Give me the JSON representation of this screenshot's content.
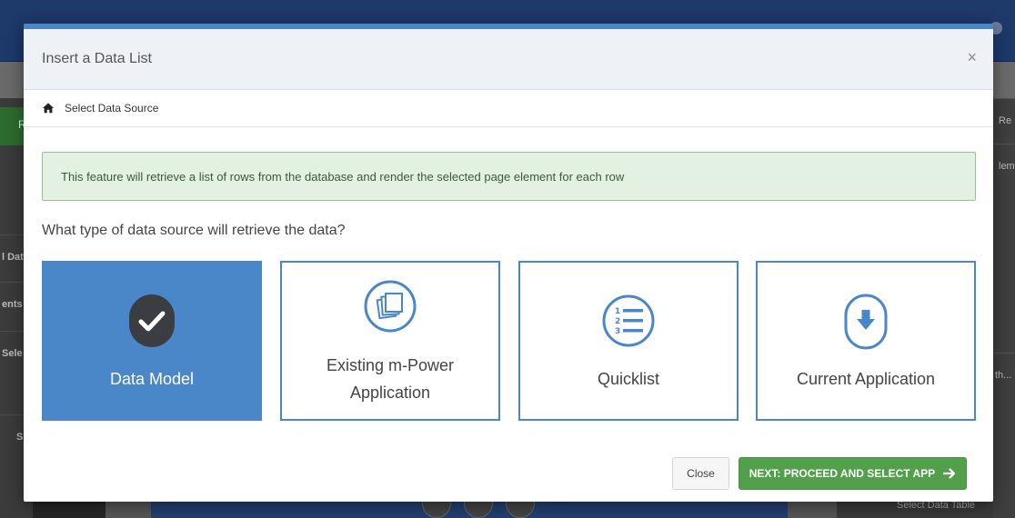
{
  "background": {
    "left_items": [
      "R",
      "l Dat",
      "ents",
      "Sele",
      "S"
    ],
    "right_items": [
      "Re",
      "lem",
      "th...",
      ""
    ],
    "bottom_right_label": "Select Data Table"
  },
  "modal": {
    "title": "Insert a Data List",
    "close_symbol": "×",
    "breadcrumb": "Select Data Source",
    "alert": "This feature will retrieve a list of rows from the database and render the selected page element for each row",
    "question": "What type of data source will retrieve the data?",
    "cards": [
      {
        "label": "Data Model",
        "icon": "check-icon",
        "selected": true
      },
      {
        "label_line1": "Existing m-Power",
        "label_line2": "Application",
        "icon": "copy-pages-icon",
        "selected": false
      },
      {
        "label": "Quicklist",
        "icon": "numbered-list-icon",
        "selected": false
      },
      {
        "label": "Current Application",
        "icon": "download-arrow-icon",
        "selected": false
      }
    ],
    "buttons": {
      "close": "Close",
      "next": "NEXT: PROCEED AND SELECT APP"
    }
  },
  "colors": {
    "accent": "#4a87c8",
    "success": "#52a04c",
    "alert_bg": "#e3f1e3"
  }
}
